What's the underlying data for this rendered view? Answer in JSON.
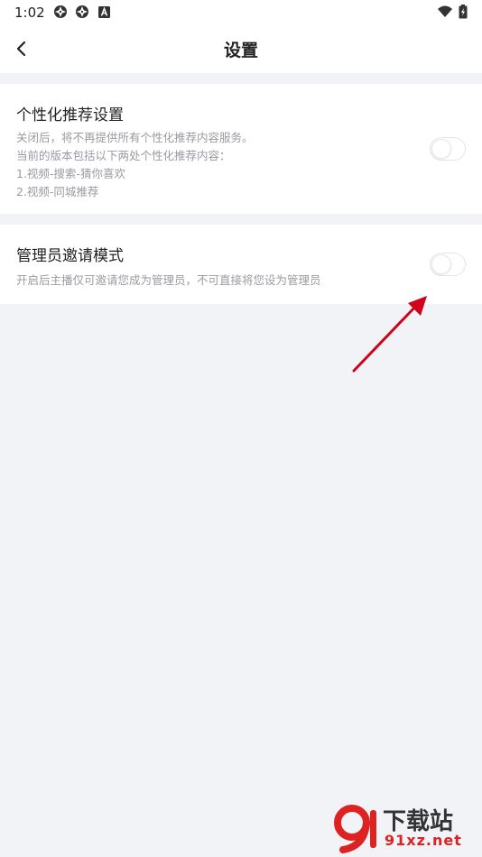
{
  "status_bar": {
    "time": "1:02",
    "icons": [
      "aperture-icon",
      "aperture-icon",
      "a-badge-icon"
    ],
    "right_icons": [
      "wifi-icon",
      "battery-charging-icon"
    ]
  },
  "nav": {
    "title": "设置",
    "back_icon": "chevron-left-icon"
  },
  "settings": [
    {
      "title": "个性化推荐设置",
      "description_lines": [
        "关闭后，将不再提供所有个性化推荐内容服务。",
        "当前的版本包括以下两处个性化推荐内容：",
        "1.视频-搜索-猜你喜欢",
        "2.视频-同城推荐"
      ],
      "enabled": false
    },
    {
      "title": "管理员邀请模式",
      "description_lines": [
        "开启后主播仅可邀请您成为管理员，不可直接将您设为管理员"
      ],
      "enabled": false
    }
  ],
  "watermark": {
    "main": "下载站",
    "sub": "91xz.net"
  },
  "colors": {
    "page_background": "#f2f3f7",
    "card_background": "#ffffff",
    "description_text": "#9a9aa2",
    "annotation_arrow": "#d0021b"
  }
}
